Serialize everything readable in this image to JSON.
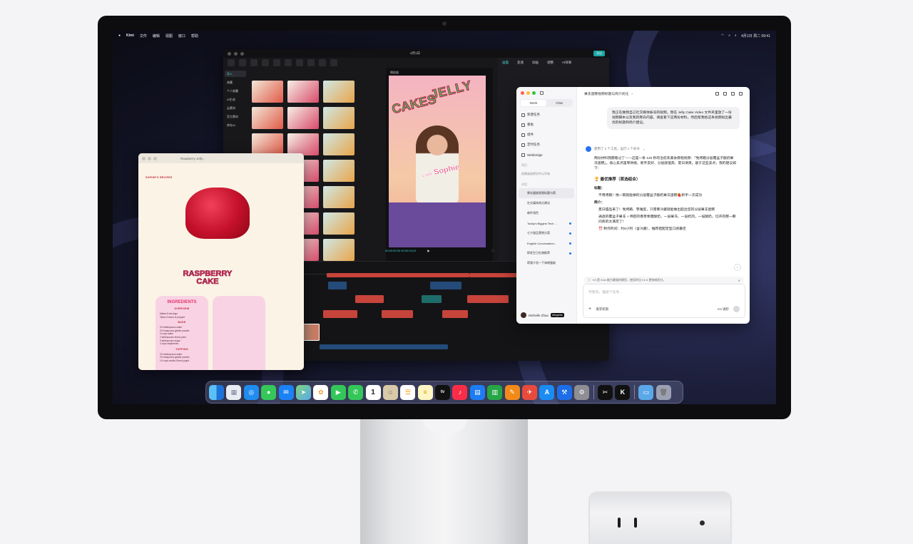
{
  "menubar": {
    "app_name": "Kimi",
    "menus": [
      "文件",
      "编辑",
      "视图",
      "窗口",
      "帮助"
    ],
    "datetime": "4月1日 周二 09:41"
  },
  "capcut": {
    "project_title": "4月1日",
    "export_label": "导出",
    "sidebar": [
      "导入",
      "收藏",
      "个人收藏",
      "AI生成",
      "云素材",
      "官方素材",
      "库存AI"
    ],
    "tabs": [
      "画面",
      "变速",
      "动画",
      "调整",
      "AI效果"
    ],
    "preview_label": "播放器",
    "timecode": "00:00:00:00  00:00:04:22",
    "poster_text": {
      "line1": "JELLY",
      "line2": "CAKES",
      "with": "with",
      "name": "Sophie"
    }
  },
  "recipe": {
    "window_title": "Raspberry Jelly...",
    "subtitle": "SOPHIE'S RECIPES",
    "title": "RASPBERRY CAKE",
    "card_left": {
      "heading": "INGREDIENTS",
      "overview_label": "OVERVIEW",
      "overview_text": "Makes 8 servings\nTakes 5 hours to prepare",
      "base_label": "BASE",
      "base_text": "2½ tablespoons water\n2½ teaspoons gelatin powder\n½ cups water\n2 tablespoons lemon juice\n3 tablespoons sugar\n2 cups raspberries",
      "topping_label": "TOPPING",
      "topping_text": "2½ tablespoons water\n2½ teaspoons gelatin powder\n1½ cups vanilla Greek yogurt"
    }
  },
  "kimi": {
    "mode_tabs": [
      "Work",
      "Chat"
    ],
    "nav": [
      "新建任务",
      "看板",
      "组件",
      "定时任务",
      "Webbridge"
    ],
    "projects_label": "项目",
    "projects_hint": "创建或选择文件以开始",
    "history_label": "对话",
    "history": [
      "果冻蛋糕视频标题与简",
      "社交媒体热点建议",
      "邮件润色",
      "Today's Biggest Tech ...",
      "七夕甜品营销方案",
      "English Conversation...",
      "探发生日礼物推荐",
      "帮我介绍一下海绵蛋糕"
    ],
    "user_name": "Michelle Zhao",
    "user_badge": "Allegretto",
    "chat_title": "果冻蛋糕视频标题与简介优化",
    "user_message": "我正在做我自己社交媒体账号的视频。我在 Jelly Cake Video 文件夹里放了一份视频脚本以及我的旁白内容，请查看下这两份材料，然后帮我给这条视频拟出最优的标题和简介建议。",
    "tools_used": "使用了 2 个工具，运行 1 个命令",
    "answer_intro": "两份材料我都看过了——这是一条 120 秒的治愈系美食教程视频：「免烤箱分层覆盆子酸奶果冻蛋糕」。核心卖点是零烘焙、新手友好、分层颜值高、夏日清爽。基于这些卖点，我的建议如下：",
    "answer_heading": "🏆 最优推荐（首选组合）",
    "title_label": "标题：",
    "title_value": "不用烤箱！挽一碗就能做的分层覆盆子酸奶果冻蛋糕🍓新手一次成功",
    "intro_label": "简介：",
    "intro_value_1": "夏日甜品来了！免烤箱、零难度，只需要冷藏就能做出超出您的分层果冻蛋糕",
    "intro_value_2": "通透的覆盆子果冻 + 绵密的香草希腊酸奶，一层果冻、一层奶肉，一层酸奶，切开的那一瞬间真的太满足了！",
    "intro_value_3": "⏰ 制作时间：约5小时（含冷藏），推荐搭配定型口感最佳",
    "notice": "K3 是 Kimi 能力最强的模型，使用时比 K2.6 更快耗积分。",
    "input_placeholder": "尽管问，描述个任务...",
    "input_add": "+",
    "input_tool": "请求权限",
    "input_model": "K3 进阶"
  },
  "dock": {
    "apps": [
      "finder-icon",
      "launchpad-icon",
      "safari-icon",
      "messages-icon",
      "mail-icon",
      "maps-icon",
      "photos-icon",
      "facetime-icon",
      "phone-icon",
      "calendar-icon",
      "contacts-icon",
      "reminders-icon",
      "notes-icon",
      "tv-icon",
      "music-icon",
      "keynote-icon",
      "numbers-icon",
      "pages-icon",
      "testflight-icon",
      "app-store-icon",
      "xcode-icon",
      "settings-icon",
      "capcut-icon",
      "kimi-icon",
      "downloads-folder-icon",
      "trash-icon"
    ],
    "calendar_day": "1",
    "tv_label": "tv"
  }
}
